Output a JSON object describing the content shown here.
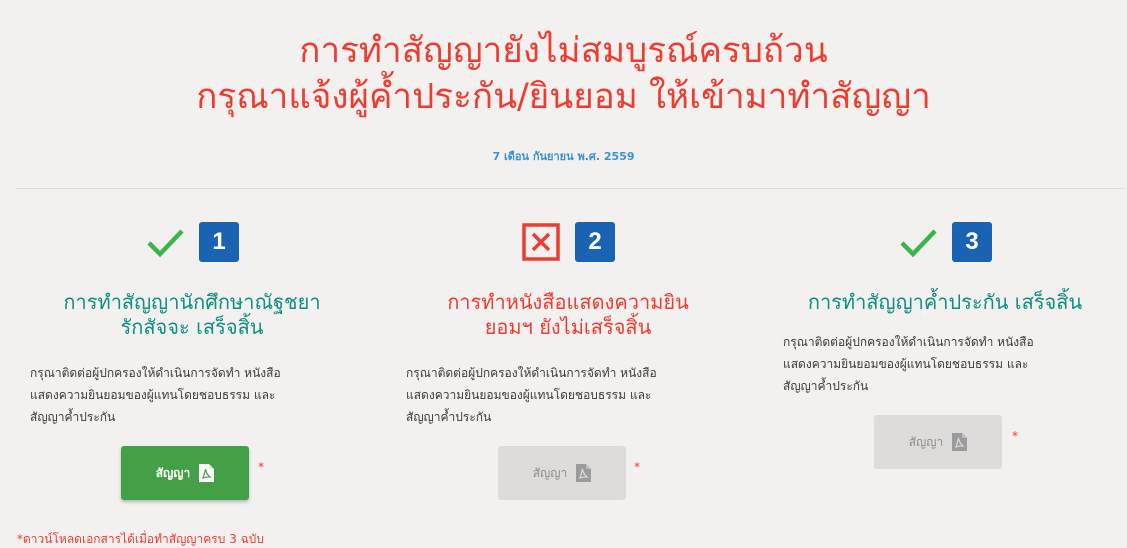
{
  "header": {
    "title_line1": "การทำสัญญายังไม่สมบูรณ์ครบถ้วน",
    "title_line2": "กรุณาแจ้งผู้ค้ำประกัน/ยินยอม ให้เข้ามาทำสัญญา",
    "date": "7 เดือน กันยายน พ.ศ. 2559"
  },
  "steps": [
    {
      "number": "1",
      "status": "complete",
      "title_line1": "การทำสัญญานักศึกษาณัฐชยา",
      "title_line2": "รักสัจจะ เสร็จสิ้น",
      "desc_line1": "กรุณาติดต่อผู้ปกครองให้ดำเนินการจัดทำ หนังสือ",
      "desc_line2": "แสดงความยินยอมของผู้แทนโดยชอบธรรม และ",
      "desc_line3": "สัญญาค้ำประกัน",
      "button_label": "สัญญา",
      "button_enabled": true,
      "required_mark": "*"
    },
    {
      "number": "2",
      "status": "incomplete",
      "title_line1": "การทำหนังสือแสดงความยิน",
      "title_line2": "ยอมฯ ยังไม่เสร็จสิ้น",
      "desc_line1": "กรุณาติดต่อผู้ปกครองให้ดำเนินการจัดทำ หนังสือ",
      "desc_line2": "แสดงความยินยอมของผู้แทนโดยชอบธรรม และ",
      "desc_line3": "สัญญาค้ำประกัน",
      "button_label": "สัญญา",
      "button_enabled": false,
      "required_mark": "*"
    },
    {
      "number": "3",
      "status": "complete",
      "title_line1": "การทำสัญญาค้ำประกัน เสร็จสิ้น",
      "desc_line1": "กรุณาติดต่อผู้ปกครองให้ดำเนินการจัดทำ หนังสือ",
      "desc_line2": "แสดงความยินยอมของผู้แทนโดยชอบธรรม และ",
      "desc_line3": "สัญญาค้ำประกัน",
      "button_label": "สัญญา",
      "button_enabled": false,
      "required_mark": "*"
    }
  ],
  "footnote": "*ดาวน์โหลดเอกสารได้เมื่อทำสัญญาครบ 3 ฉบับ",
  "colors": {
    "title_red": "#ef3c30",
    "success_teal": "#0e8f82",
    "check_green": "#3bb54a",
    "number_blue": "#1a63b3",
    "date_blue": "#3a92d8",
    "button_green": "#43a047",
    "button_disabled": "#dddcda"
  },
  "icons": {
    "complete": "check-icon",
    "incomplete": "x-box-icon",
    "button": "pdf-icon"
  }
}
